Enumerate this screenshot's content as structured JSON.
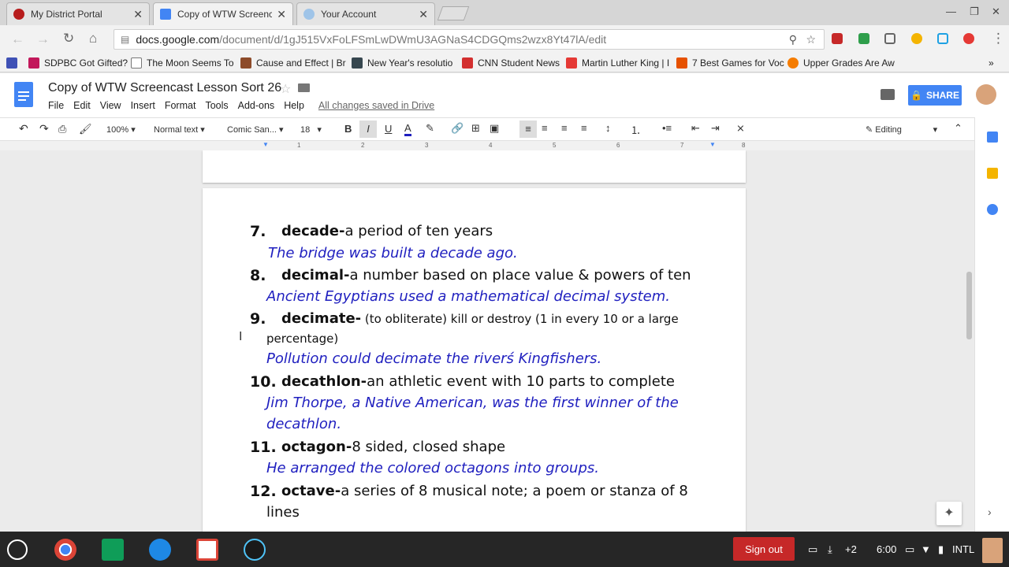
{
  "browser": {
    "tabs": [
      {
        "title": "My District Portal",
        "active": false
      },
      {
        "title": "Copy of WTW Screencas",
        "active": true
      },
      {
        "title": "Your Account",
        "active": false
      }
    ],
    "url_host": "docs.google.com",
    "url_path": "/document/d/1gJ515VxFoLFSmLwDWmU3AGNaS4CDGQms2wzx8Yt47lA/edit",
    "bookmarks": [
      "SDPBC Got Gifted?",
      "The Moon Seems To",
      "Cause and Effect | Br",
      "New Year's resolutio",
      "CNN Student News",
      "Martin Luther King | I",
      "7 Best Games for Voc",
      "Upper Grades Are Aw"
    ]
  },
  "docs": {
    "title": "Copy of WTW Screencast Lesson Sort 26",
    "menu": [
      "File",
      "Edit",
      "View",
      "Insert",
      "Format",
      "Tools",
      "Add-ons",
      "Help"
    ],
    "saved_status": "All changes saved in Drive",
    "share_label": "SHARE",
    "toolbar": {
      "zoom": "100%",
      "style": "Normal text",
      "font": "Comic San...",
      "size": "18",
      "mode": "Editing"
    },
    "ruler_numbers": [
      "1",
      "1",
      "2",
      "3",
      "4",
      "5",
      "6",
      "7",
      "8"
    ]
  },
  "entries": [
    {
      "num": "7.",
      "term": "decade-",
      "def": "a period of ten years",
      "example": "The bridge was built a decade ago."
    },
    {
      "num": "8.",
      "term": "decimal-",
      "def": "a number based on place value & powers of ten",
      "example": "Ancient Egyptians used a mathematical decimal system."
    },
    {
      "num": "9.",
      "term": "decimate-",
      "def": " (to obliterate) kill or destroy (1 in every 10 or a large",
      "def2": "percentage)",
      "example": "Pollution could decimate the riverś Kingfishers."
    },
    {
      "num": "10.",
      "term": "decathlon-",
      "def": "an athletic event with 10 parts to complete",
      "example": "Jim Thorpe, a Native American, was the first winner of the",
      "example2": "decathlon."
    },
    {
      "num": "11.",
      "term": "octagon-",
      "def": "8 sided, closed shape",
      "example": "He arranged the colored octagons into groups."
    },
    {
      "num": "12.",
      "term": "octave-",
      "def": "a series of 8 musical note; a poem or stanza of 8",
      "def2": "lines"
    }
  ],
  "shelf": {
    "sign_out": "Sign out",
    "notification_count": "+2",
    "time": "6:00",
    "ime": "INTL"
  },
  "colors": {
    "example_text": "#1f1fbf",
    "share_button": "#4285f4",
    "sign_out": "#c62828"
  }
}
